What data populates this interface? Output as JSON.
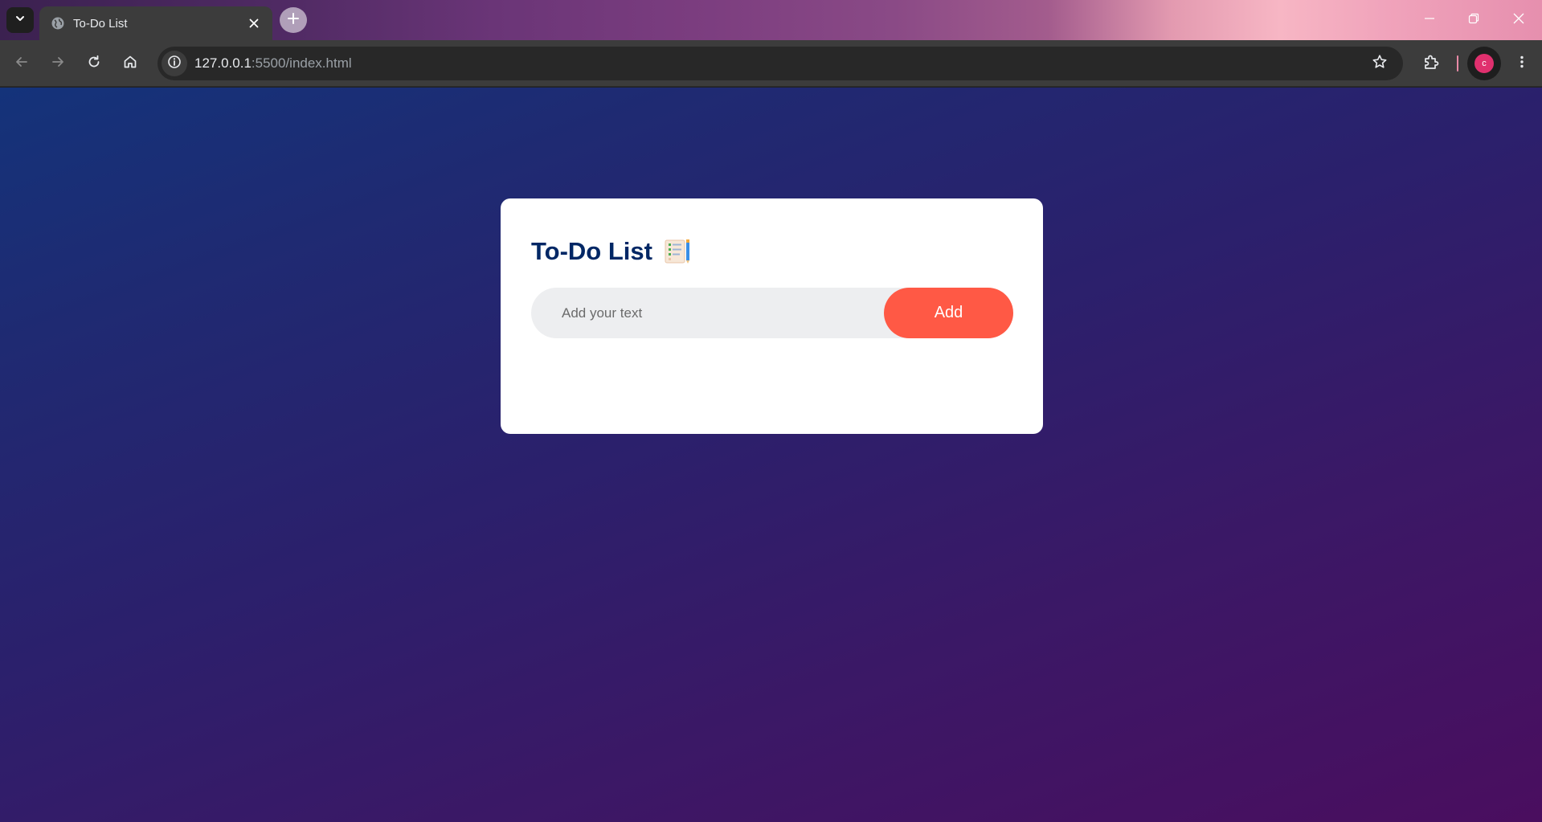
{
  "browser": {
    "tab": {
      "title": "To-Do List",
      "favicon": "globe-icon"
    },
    "address": {
      "host": "127.0.0.1",
      "path": ":5500/index.html"
    },
    "profile": {
      "initial": "c",
      "color": "#e0306e"
    }
  },
  "app": {
    "title": "To-Do List",
    "title_icon": "notepad-checklist-icon",
    "input": {
      "placeholder": "Add your text",
      "value": ""
    },
    "add_button": "Add",
    "tasks": []
  },
  "colors": {
    "accent": "#ff5945",
    "title": "#002765",
    "input_bg": "#edeef0",
    "gradient_start": "#14337a",
    "gradient_end": "#4a0e5f"
  }
}
